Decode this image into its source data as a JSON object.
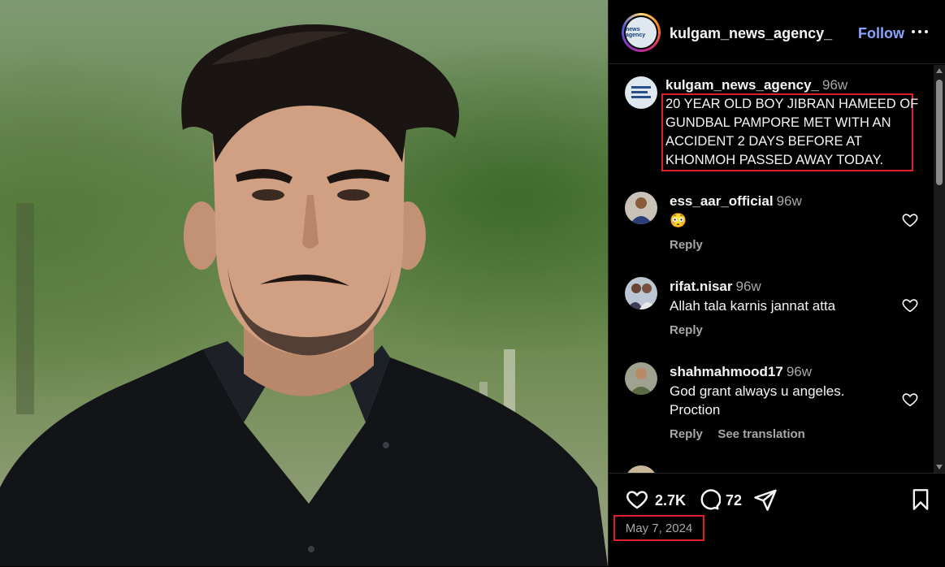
{
  "post": {
    "username": "kulgam_news_agency_",
    "follow_label": "Follow",
    "avatar_text": "news agency"
  },
  "caption": {
    "username": "kulgam_news_agency_",
    "age": "96w",
    "lines": [
      "20 YEAR OLD BOY JIBRAN HAMEED OF",
      "GUNDBAL PAMPORE  MET WITH AN",
      "ACCIDENT 2 DAYS BEFORE AT",
      "KHONMOH PASSED AWAY TODAY."
    ]
  },
  "comments": [
    {
      "username": "ess_aar_official",
      "age": "96w",
      "text": "😳",
      "reply": "Reply"
    },
    {
      "username": "rifat.nisar",
      "age": "96w",
      "text": "Allah tala karnis jannat atta",
      "reply": "Reply"
    },
    {
      "username": "shahmahmood17",
      "age": "96w",
      "text_lines": [
        "God grant always u angeles.",
        "Proction"
      ],
      "reply": "Reply",
      "translate": "See translation"
    }
  ],
  "actions": {
    "likes": "2.7K",
    "comments": "72",
    "date": "May 7, 2024"
  },
  "colors": {
    "accent_follow": "#8aa4ff",
    "highlight_box": "#e01e2b",
    "muted_text": "#a8a8a8"
  }
}
